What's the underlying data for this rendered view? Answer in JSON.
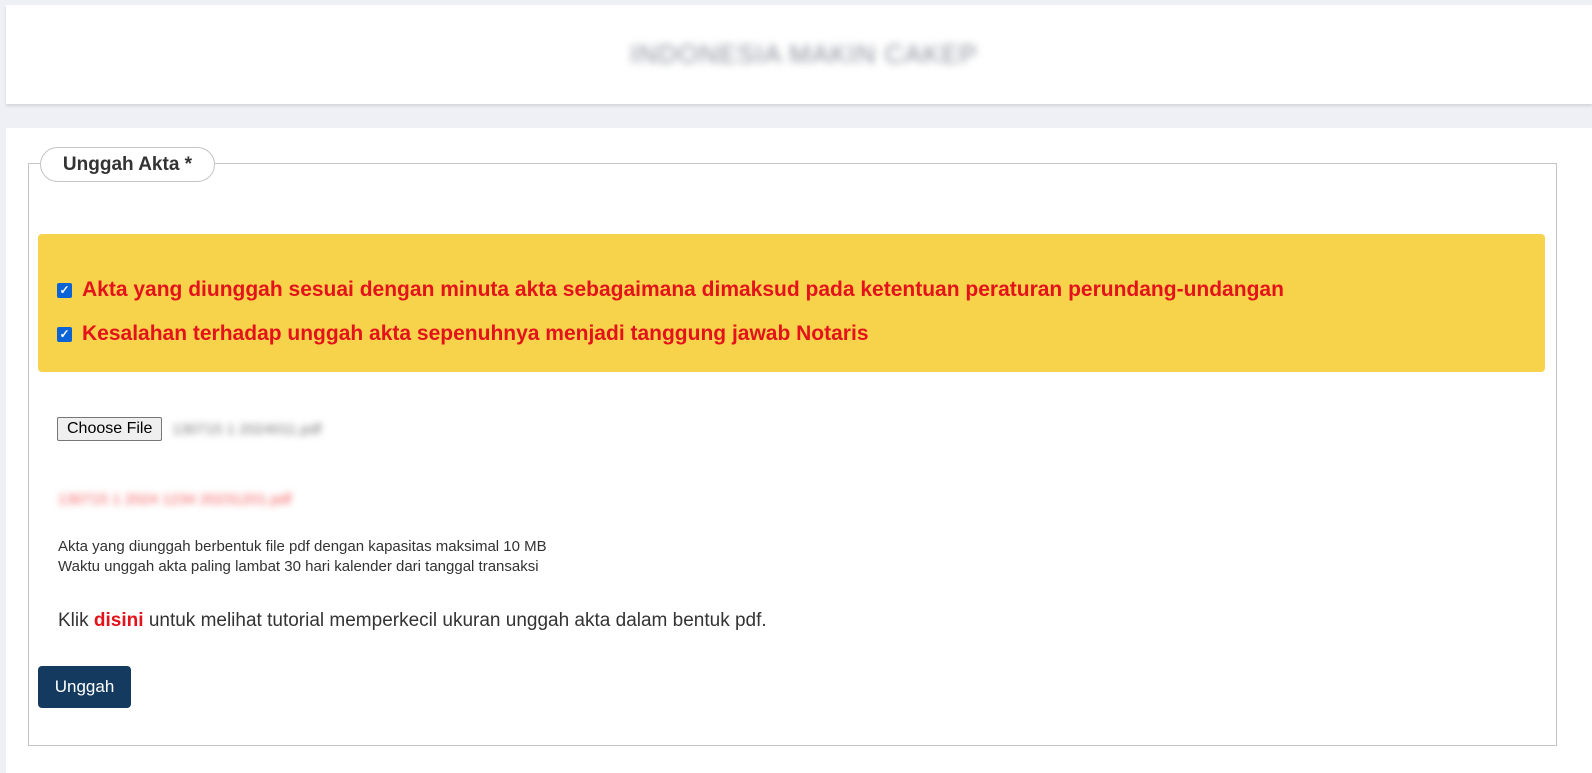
{
  "header": {
    "title": "INDONESIA MAKIN CAKEP"
  },
  "form": {
    "legend": "Unggah Akta *",
    "agreements": [
      {
        "label": "Akta yang diunggah sesuai dengan minuta akta sebagaimana dimaksud pada ketentuan peraturan perundang-undangan",
        "checked": true
      },
      {
        "label": "Kesalahan terhadap unggah akta sepenuhnya menjadi tanggung jawab Notaris",
        "checked": true
      }
    ],
    "file_input": {
      "button_label": "Choose File",
      "file_name": "130715 1 2024011.pdf"
    },
    "uploaded_file": "130715 1 2024 1234 20231201.pdf",
    "notes": [
      "Akta yang diunggah berbentuk file pdf dengan kapasitas maksimal 10 MB",
      "Waktu unggah akta paling lambat 30 hari kalender dari tanggal transaksi"
    ],
    "tutorial": {
      "prefix": "Klik",
      "link": "disini",
      "suffix": "untuk melihat tutorial memperkecil ukuran unggah akta dalam bentuk pdf."
    },
    "submit_label": "Unggah"
  },
  "colors": {
    "alert_bg": "#f7d34b",
    "alert_text": "#e3121b",
    "primary_button": "#153a5f"
  }
}
